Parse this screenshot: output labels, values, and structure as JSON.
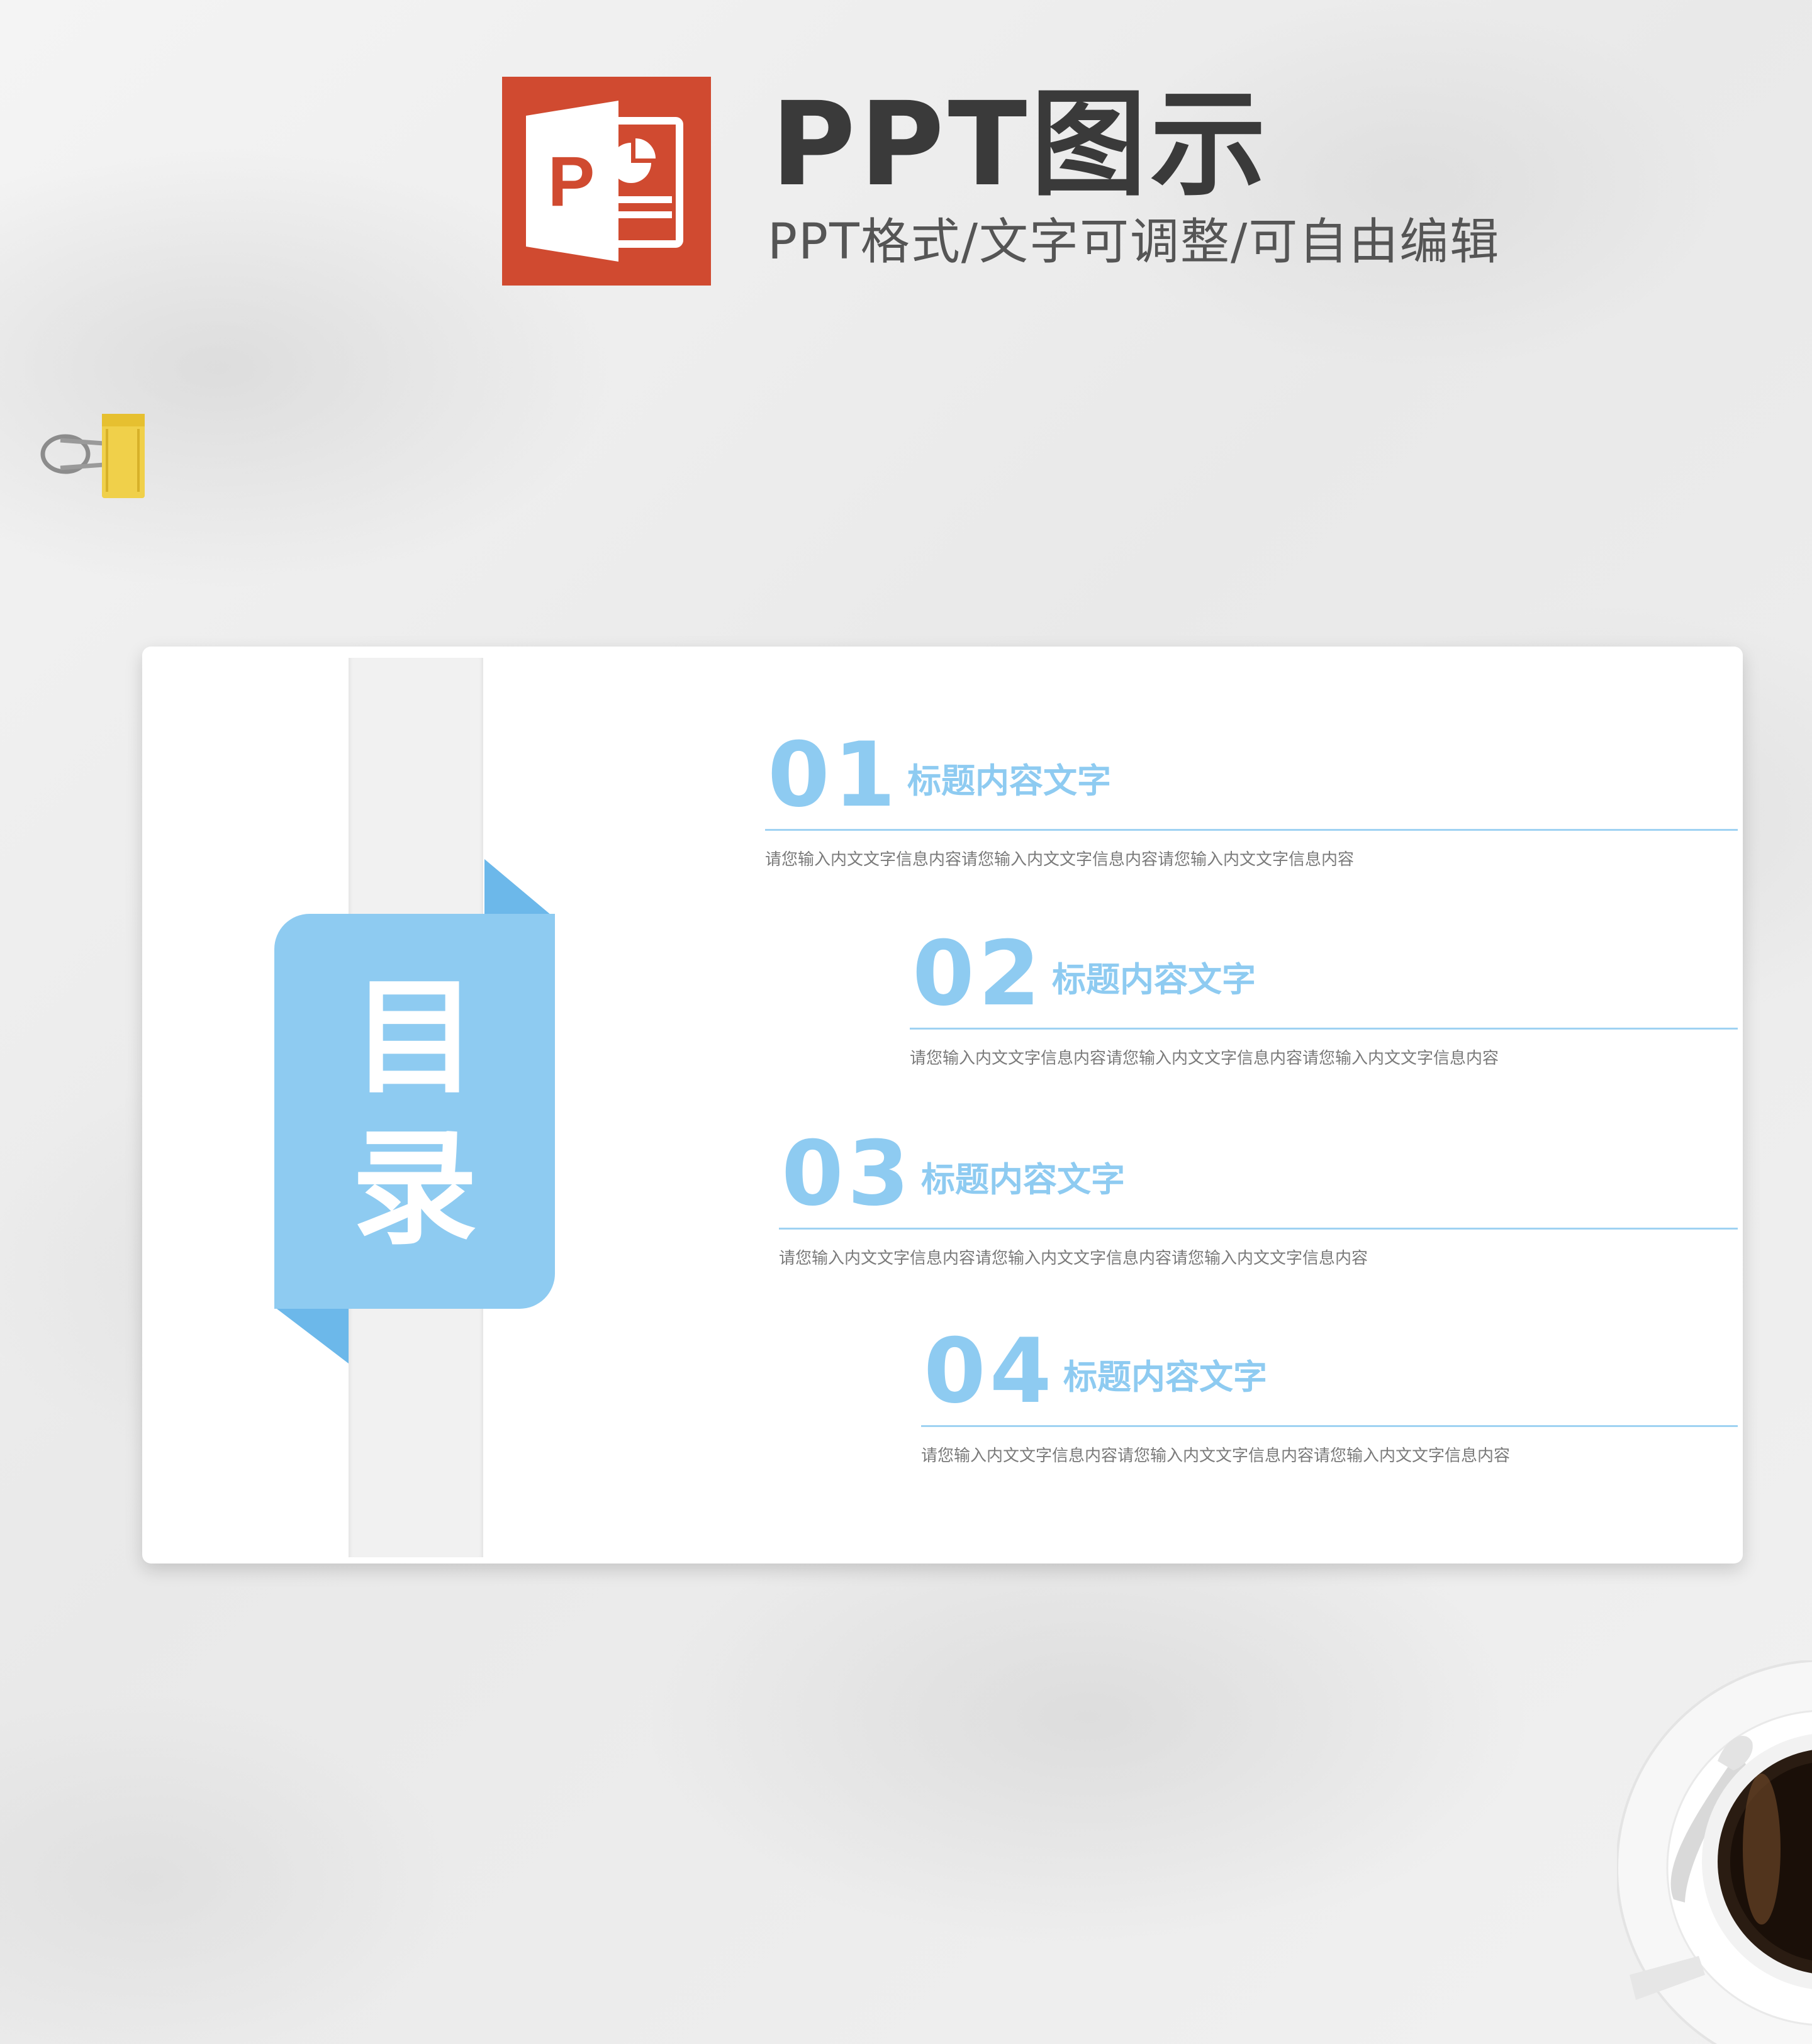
{
  "header": {
    "title": "PPT图示",
    "subtitle": "PPT格式/文字可调整/可自由编辑",
    "logo_icon": "powerpoint-icon",
    "logo_color": "#d04a30"
  },
  "slide": {
    "ribbon_title": "目\n录",
    "accent_color": "#8ecbf1",
    "items": [
      {
        "number": "01",
        "title": "标题内容文字",
        "desc": "请您输入内文文字信息内容请您输入内文文字信息内容请您输入内文文字信息内容"
      },
      {
        "number": "02",
        "title": "标题内容文字",
        "desc": "请您输入内文文字信息内容请您输入内文文字信息内容请您输入内文文字信息内容"
      },
      {
        "number": "03",
        "title": "标题内容文字",
        "desc": "请您输入内文文字信息内容请您输入内文文字信息内容请您输入内文文字信息内容"
      },
      {
        "number": "04",
        "title": "标题内容文字",
        "desc": "请您输入内文文字信息内容请您输入内文文字信息内容请您输入内文文字信息内容"
      }
    ]
  },
  "decor": {
    "clip_icon": "binder-clip-icon",
    "coffee_icon": "coffee-cup-icon"
  }
}
